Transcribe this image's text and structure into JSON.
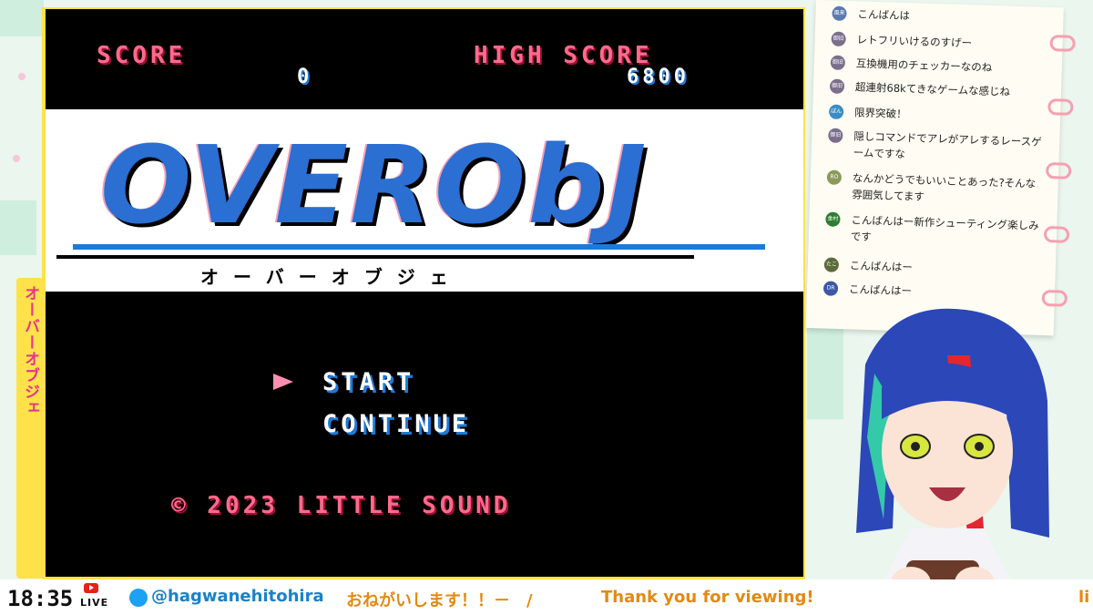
{
  "theme": {
    "accent_pink": "#e8338a",
    "frame_yellow": "#ffe24a",
    "game_bg": "#000000",
    "pixel_blue": "#1e7ad6",
    "ticker_orange": "#e28a12",
    "twitter_blue": "#1da1f2"
  },
  "side_tab": {
    "title": "オーバーオブジェ"
  },
  "game": {
    "score_label": "SCORE",
    "score_value": "0",
    "high_score_label": "HIGH SCORE",
    "high_score_value": "6800",
    "logo": "OVERObJ",
    "logo_kana": "オーバーオブジェ",
    "menu": {
      "cursor_icon": "triangle-right-icon",
      "items": [
        "START",
        "CONTINUE"
      ],
      "selected": "START"
    },
    "copyright": "© 2023 LITTLE SOUND"
  },
  "chat": {
    "messages": [
      {
        "avatar": "風来",
        "text": "こんばんは"
      },
      {
        "avatar": "御旧",
        "text": "レトフリいけるのすげー"
      },
      {
        "avatar": "御旧",
        "text": "互換機用のチェッカーなのね"
      },
      {
        "avatar": "御旧",
        "text": "超連射68kてきなゲームな感じね"
      },
      {
        "avatar": "ぽん",
        "text": "限界突破！"
      },
      {
        "avatar": "御旧",
        "text": "隠しコマンドでアレがアレするレースゲームですな"
      },
      {
        "avatar": "RO",
        "text": "なんかどうでもいいことあった?そんな雰囲気してます"
      },
      {
        "avatar": "金村",
        "text": "こんばんはー新作シューティング楽しみです"
      },
      {
        "avatar": "たこ",
        "text": "こんばんはー"
      },
      {
        "avatar": "DR",
        "text": "こんばんはー"
      }
    ]
  },
  "bottom_bar": {
    "clock": "18:35",
    "live_label": "LIVE",
    "youtube_icon": "youtube-icon",
    "twitter_icon": "twitter-icon",
    "handle": "@hagwanehitohira",
    "ticker_1": "おねがいします！！－　/",
    "ticker_2": "Thank you for viewing!",
    "ticker_3": "li"
  }
}
